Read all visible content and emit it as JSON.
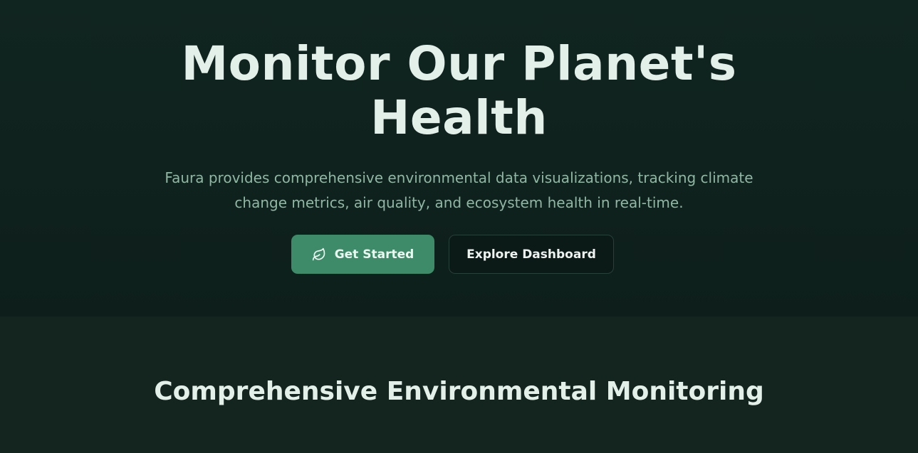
{
  "hero": {
    "title_line1": "Monitor Our Planet's",
    "title_line2": "Health",
    "subtitle": "Faura provides comprehensive environmental data visualizations, tracking climate change metrics, air quality, and ecosystem health in real-time.",
    "primary_button": {
      "label": "Get Started",
      "icon": "leaf-icon"
    },
    "secondary_button": {
      "label": "Explore Dashboard"
    }
  },
  "features": {
    "title": "Comprehensive Environmental Monitoring"
  },
  "colors": {
    "hero_bg": "#0e1f1b",
    "section_bg": "#142520",
    "accent": "#3d8b68",
    "heading": "#e3efe9",
    "subtitle": "#8fb7a3"
  }
}
